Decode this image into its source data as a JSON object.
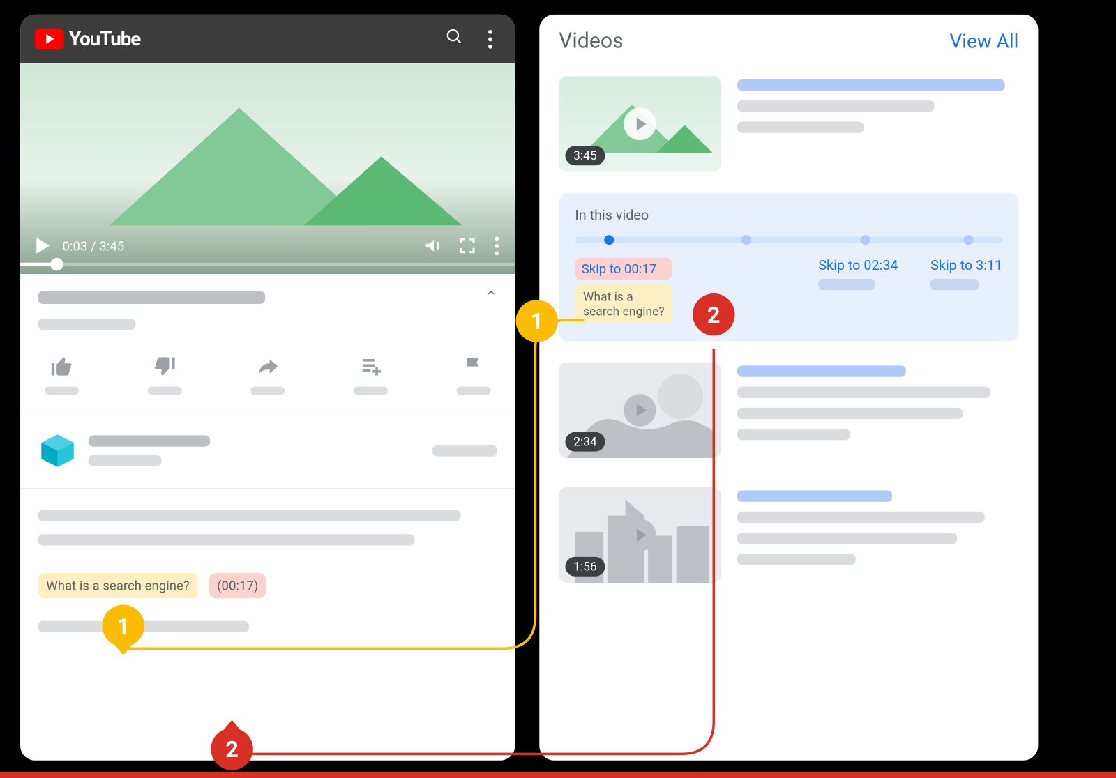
{
  "left": {
    "brand": "YouTube",
    "timeElapsed": "0:03",
    "timeTotal": "3:45",
    "desc_chip_title": "What is a search engine?",
    "desc_chip_time": "(00:17)"
  },
  "right": {
    "heading": "Videos",
    "viewAll": "View All",
    "videos": [
      {
        "duration": "3:45"
      },
      {
        "duration": "2:34"
      },
      {
        "duration": "1:56"
      }
    ],
    "moments": {
      "header": "In this video",
      "items": [
        {
          "skip": "Skip to 00:17",
          "label": "What is a\nsearch engine?"
        },
        {
          "skip": "Skip to 02:34"
        },
        {
          "skip": "Skip to 3:11"
        }
      ]
    }
  },
  "callouts": {
    "one": "1",
    "two": "2"
  }
}
